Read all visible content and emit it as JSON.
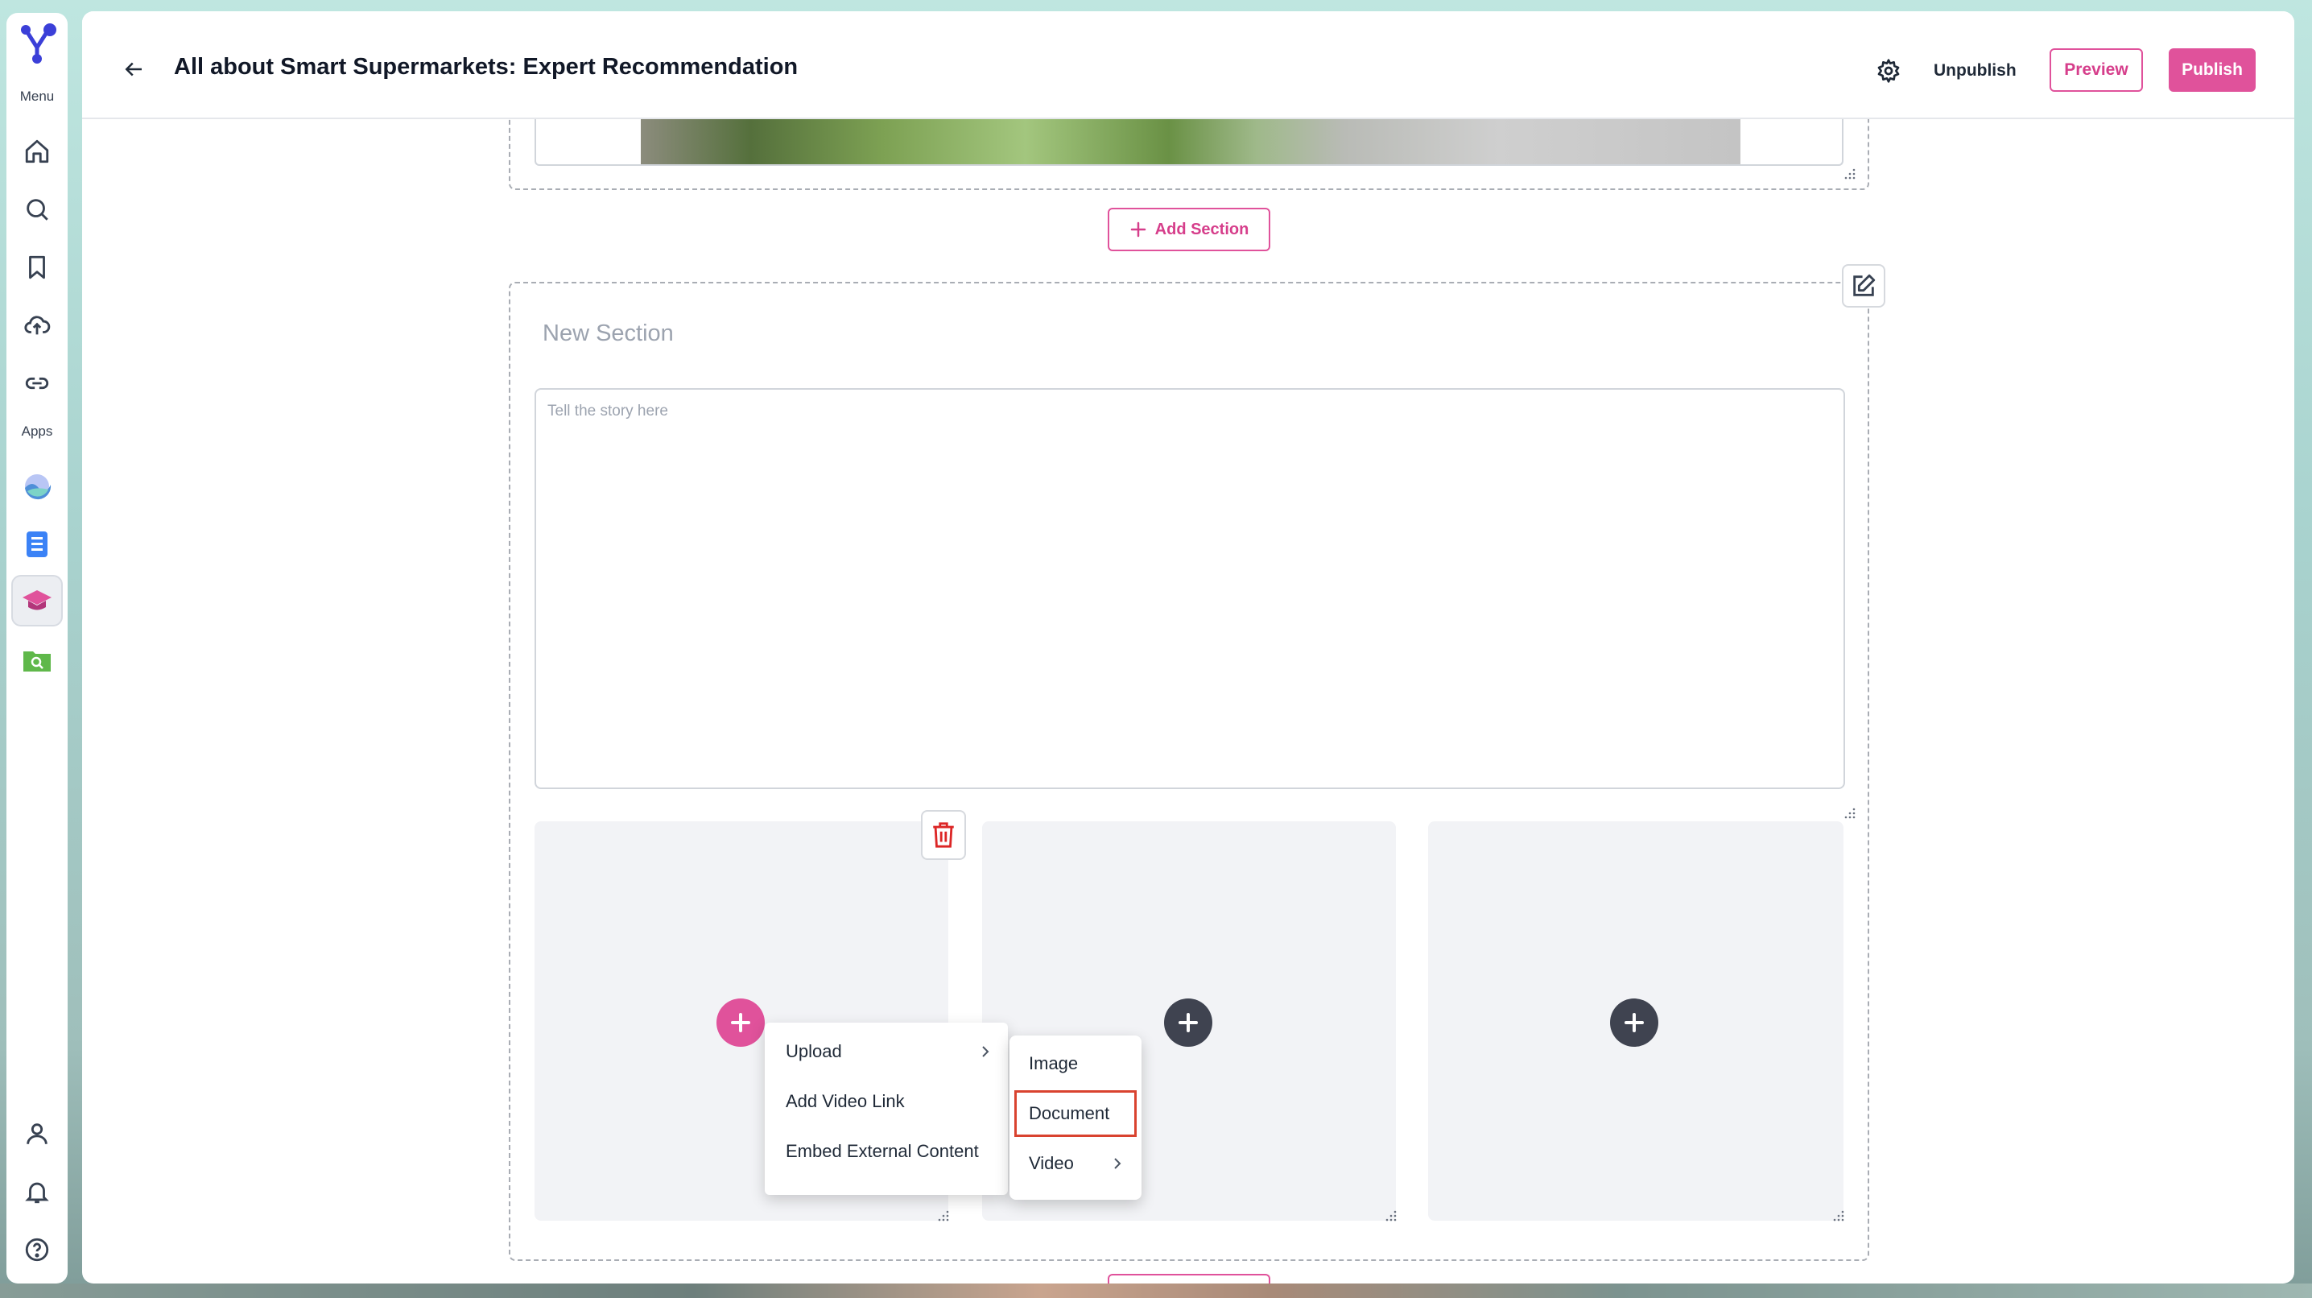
{
  "sidebar": {
    "menu_label": "Menu",
    "apps_label": "Apps",
    "icons": [
      "logo-icon",
      "home-icon",
      "search-icon",
      "bookmark-icon",
      "upload-cloud-icon",
      "link-icon",
      "app-wave-icon",
      "app-document-icon",
      "app-graduation-cap-icon",
      "app-folder-search-icon",
      "user-icon",
      "bell-icon",
      "help-icon"
    ],
    "accent_colors": {
      "logo": "#3b3fd8",
      "active_app": "#e0529b",
      "doc_app": "#3b82f6",
      "folder_app": "#5fb84a"
    }
  },
  "header": {
    "title": "All about Smart Supermarkets: Expert Recommendation",
    "unpublish_label": "Unpublish",
    "preview_label": "Preview",
    "publish_label": "Publish"
  },
  "editor": {
    "add_section_label": "Add Section",
    "section": {
      "title_placeholder": "New Section",
      "story_placeholder": "Tell the story here"
    },
    "add_menu": {
      "items": [
        {
          "label": "Upload",
          "has_submenu": true
        },
        {
          "label": "Add Video Link"
        },
        {
          "label": "Embed External Content"
        }
      ]
    },
    "upload_submenu": {
      "items": [
        {
          "label": "Image"
        },
        {
          "label": "Document",
          "highlighted": true
        },
        {
          "label": "Video",
          "has_submenu": true
        }
      ]
    }
  },
  "colors": {
    "brand_pink": "#e0529b",
    "highlight_red": "#d9432f",
    "dark_add": "#3f4350"
  }
}
